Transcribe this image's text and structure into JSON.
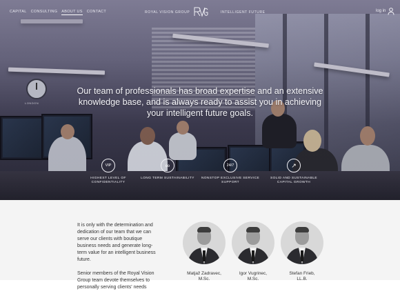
{
  "nav": {
    "links": [
      "CAPITAL",
      "CONSULTING",
      "ABOUT US",
      "CONTACT"
    ],
    "active_link": "ABOUT US",
    "brand_left": "ROYAL VISION GROUP",
    "logo_text": "RVG",
    "brand_right": "INTELLIGENT FUTURE",
    "login": "log in"
  },
  "hero": {
    "clock_label": "LONDON",
    "tagline": "Our team of professionals has broad expertise and an extensive knowledge base, and is always ready to assist you in achieving your intelligent future goals."
  },
  "features": [
    {
      "icon": "vip-icon",
      "icon_text": "VIP",
      "label": "HIGHEST LEVEL OF CONFIDENTIALITY"
    },
    {
      "icon": "infinity-icon",
      "icon_text": "∞",
      "label": "LONG TERM SUSTAINABILITY"
    },
    {
      "icon": "24-7-icon",
      "icon_text": "24/7",
      "label": "NONSTOP EXCLUSIVE SERVICE SUPPORT"
    },
    {
      "icon": "growth-arrow-icon",
      "icon_text": "↗",
      "label": "SOLID AND SUSTAINABLE CAPITAL GROWTH"
    }
  ],
  "intro": {
    "p1": "It is only with the determination and dedication of our team that we can serve our clients with boutique business needs and generate long-term value for an intelligent business future.",
    "p2": "Senior members of the Royal Vision Group team devote themselves to personally serving clients' needs"
  },
  "team": [
    {
      "name": "Matjaž Zadravec,",
      "title": "M.Sc."
    },
    {
      "name": "Igor Vugrinec,",
      "title": "M.Sc."
    },
    {
      "name": "Stefan Frieb,",
      "title": "LL.B."
    }
  ]
}
